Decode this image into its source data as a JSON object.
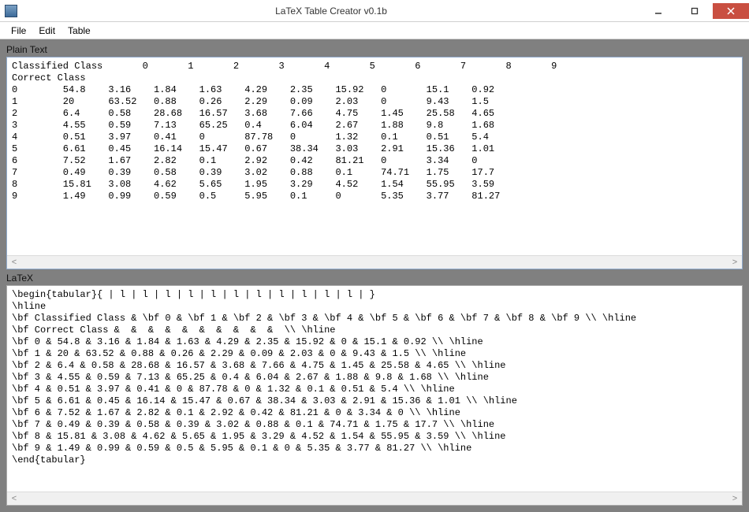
{
  "window": {
    "title": "LaTeX Table Creator v0.1b"
  },
  "menubar": {
    "items": [
      "File",
      "Edit",
      "Table"
    ]
  },
  "sections": {
    "plain_label": "Plain Text",
    "latex_label": "LaTeX"
  },
  "plain_text": {
    "header_label": "Classified Class",
    "subheader_label": "Correct Class",
    "col_headers": [
      "0",
      "1",
      "2",
      "3",
      "4",
      "5",
      "6",
      "7",
      "8",
      "9"
    ],
    "rows": [
      {
        "label": "0",
        "vals": [
          "54.8",
          "3.16",
          "1.84",
          "1.63",
          "4.29",
          "2.35",
          "15.92",
          "0",
          "15.1",
          "0.92"
        ]
      },
      {
        "label": "1",
        "vals": [
          "20",
          "63.52",
          "0.88",
          "0.26",
          "2.29",
          "0.09",
          "2.03",
          "0",
          "9.43",
          "1.5"
        ]
      },
      {
        "label": "2",
        "vals": [
          "6.4",
          "0.58",
          "28.68",
          "16.57",
          "3.68",
          "7.66",
          "4.75",
          "1.45",
          "25.58",
          "4.65"
        ]
      },
      {
        "label": "3",
        "vals": [
          "4.55",
          "0.59",
          "7.13",
          "65.25",
          "0.4",
          "6.04",
          "2.67",
          "1.88",
          "9.8",
          "1.68"
        ]
      },
      {
        "label": "4",
        "vals": [
          "0.51",
          "3.97",
          "0.41",
          "0",
          "87.78",
          "0",
          "1.32",
          "0.1",
          "0.51",
          "5.4"
        ]
      },
      {
        "label": "5",
        "vals": [
          "6.61",
          "0.45",
          "16.14",
          "15.47",
          "0.67",
          "38.34",
          "3.03",
          "2.91",
          "15.36",
          "1.01"
        ]
      },
      {
        "label": "6",
        "vals": [
          "7.52",
          "1.67",
          "2.82",
          "0.1",
          "2.92",
          "0.42",
          "81.21",
          "0",
          "3.34",
          "0"
        ]
      },
      {
        "label": "7",
        "vals": [
          "0.49",
          "0.39",
          "0.58",
          "0.39",
          "3.02",
          "0.88",
          "0.1",
          "74.71",
          "1.75",
          "17.7"
        ]
      },
      {
        "label": "8",
        "vals": [
          "15.81",
          "3.08",
          "4.62",
          "5.65",
          "1.95",
          "3.29",
          "4.52",
          "1.54",
          "55.95",
          "3.59"
        ]
      },
      {
        "label": "9",
        "vals": [
          "1.49",
          "0.99",
          "0.59",
          "0.5",
          "5.95",
          "0.1",
          "0",
          "5.35",
          "3.77",
          "81.27"
        ]
      }
    ]
  },
  "latex_lines": [
    "\\begin{tabular}{ | l | l | l | l | l | l | l | l | l | l | l | }",
    "\\hline",
    "\\bf Classified Class & \\bf 0 & \\bf 1 & \\bf 2 & \\bf 3 & \\bf 4 & \\bf 5 & \\bf 6 & \\bf 7 & \\bf 8 & \\bf 9 \\\\ \\hline",
    "\\bf Correct Class &  &  &  &  &  &  &  &  &  &  \\\\ \\hline",
    "\\bf 0 & 54.8 & 3.16 & 1.84 & 1.63 & 4.29 & 2.35 & 15.92 & 0 & 15.1 & 0.92 \\\\ \\hline",
    "\\bf 1 & 20 & 63.52 & 0.88 & 0.26 & 2.29 & 0.09 & 2.03 & 0 & 9.43 & 1.5 \\\\ \\hline",
    "\\bf 2 & 6.4 & 0.58 & 28.68 & 16.57 & 3.68 & 7.66 & 4.75 & 1.45 & 25.58 & 4.65 \\\\ \\hline",
    "\\bf 3 & 4.55 & 0.59 & 7.13 & 65.25 & 0.4 & 6.04 & 2.67 & 1.88 & 9.8 & 1.68 \\\\ \\hline",
    "\\bf 4 & 0.51 & 3.97 & 0.41 & 0 & 87.78 & 0 & 1.32 & 0.1 & 0.51 & 5.4 \\\\ \\hline",
    "\\bf 5 & 6.61 & 0.45 & 16.14 & 15.47 & 0.67 & 38.34 & 3.03 & 2.91 & 15.36 & 1.01 \\\\ \\hline",
    "\\bf 6 & 7.52 & 1.67 & 2.82 & 0.1 & 2.92 & 0.42 & 81.21 & 0 & 3.34 & 0 \\\\ \\hline",
    "\\bf 7 & 0.49 & 0.39 & 0.58 & 0.39 & 3.02 & 0.88 & 0.1 & 74.71 & 1.75 & 17.7 \\\\ \\hline",
    "\\bf 8 & 15.81 & 3.08 & 4.62 & 5.65 & 1.95 & 3.29 & 4.52 & 1.54 & 55.95 & 3.59 \\\\ \\hline",
    "\\bf 9 & 1.49 & 0.99 & 0.59 & 0.5 & 5.95 & 0.1 & 0 & 5.35 & 3.77 & 81.27 \\\\ \\hline",
    "\\end{tabular}"
  ],
  "scrollbar": {
    "left_arrow": "<",
    "right_arrow": ">"
  }
}
